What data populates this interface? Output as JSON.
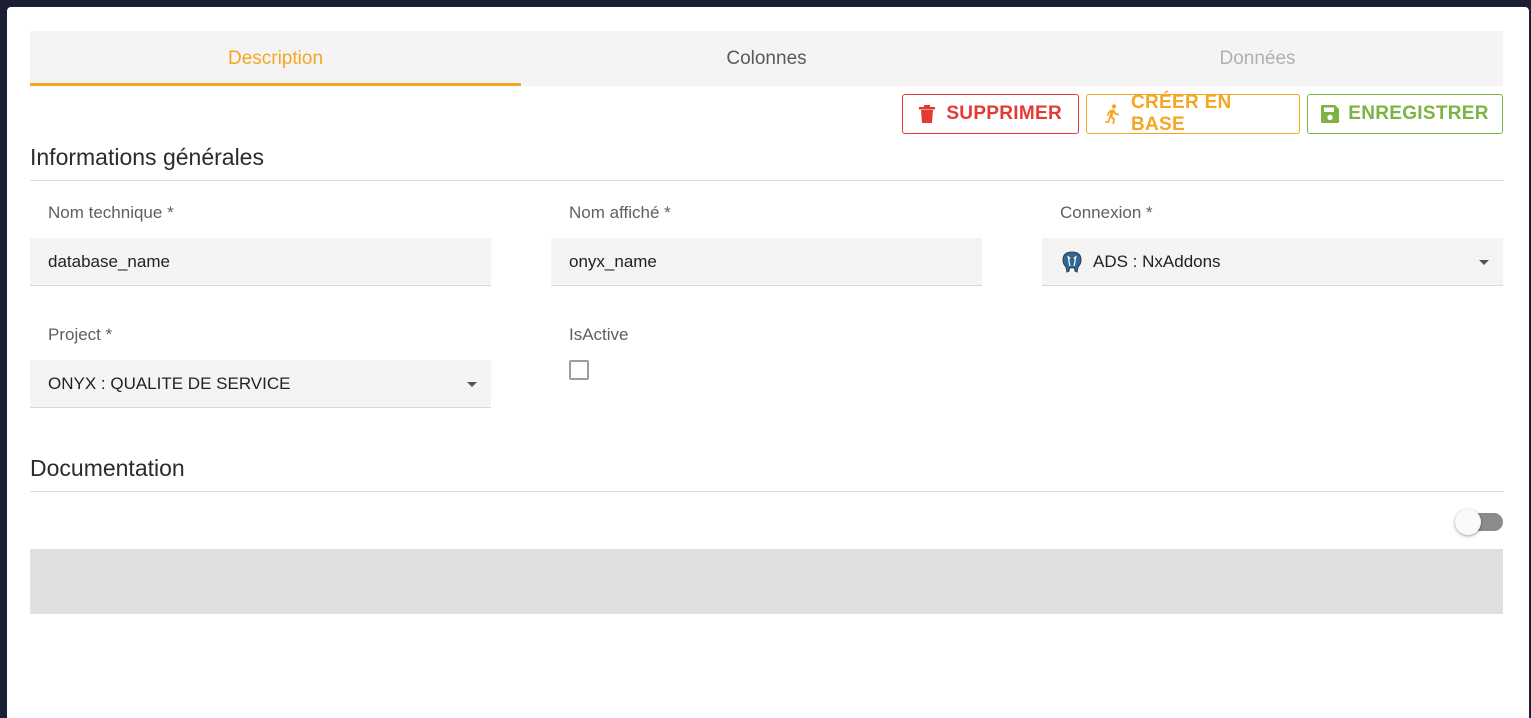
{
  "tabs": [
    {
      "label": "Description",
      "state": "active"
    },
    {
      "label": "Colonnes",
      "state": "normal"
    },
    {
      "label": "Données",
      "state": "disabled"
    }
  ],
  "actions": {
    "delete_label": "SUPPRIMER",
    "create_label": "CRÉER EN BASE",
    "save_label": "ENREGISTRER"
  },
  "colors": {
    "accent": "#f5a623",
    "danger": "#e53935",
    "success": "#7cb342",
    "background": "#1b2035"
  },
  "general": {
    "title": "Informations générales",
    "technical_name": {
      "label": "Nom technique *",
      "value": "database_name"
    },
    "display_name": {
      "label": "Nom affiché *",
      "value": "onyx_name"
    },
    "connection": {
      "label": "Connexion *",
      "value": "ADS : NxAddons",
      "icon": "postgresql-elephant-icon"
    },
    "project": {
      "label": "Project *",
      "value": "ONYX : QUALITE DE SERVICE"
    },
    "is_active": {
      "label": "IsActive",
      "checked": false
    }
  },
  "documentation": {
    "title": "Documentation",
    "toggle_on": false,
    "content": ""
  }
}
